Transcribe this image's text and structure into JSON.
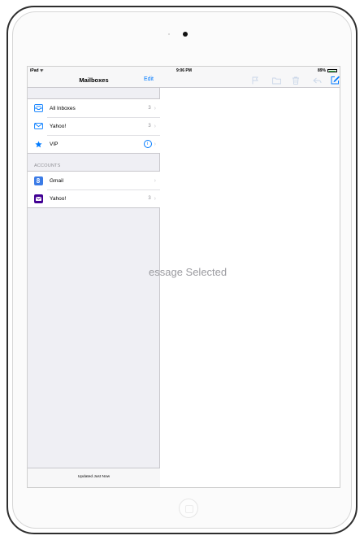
{
  "status_bar": {
    "device": "iPad",
    "time": "9:06 PM",
    "battery": "89%"
  },
  "sidebar": {
    "title": "Mailboxes",
    "edit_label": "Edit",
    "mailboxes": [
      {
        "label": "All Inboxes",
        "count": "3",
        "icon": "inbox-tray-icon"
      },
      {
        "label": "Yahoo!",
        "count": "3",
        "icon": "envelope-icon"
      },
      {
        "label": "VIP",
        "count": "",
        "icon": "star-icon"
      }
    ],
    "accounts_header": "ACCOUNTS",
    "accounts": [
      {
        "label": "Gmail",
        "count": "",
        "icon": "gmail-logo-icon"
      },
      {
        "label": "Yahoo!",
        "count": "3",
        "icon": "yahoo-logo-icon"
      }
    ],
    "footer": "Updated Just Now"
  },
  "detail": {
    "empty_message": "essage Selected",
    "toolbar_icons": [
      "flag-icon",
      "folder-icon",
      "trash-icon",
      "reply-icon",
      "compose-icon"
    ]
  },
  "colors": {
    "accent": "#007aff",
    "gmail": "#3b7be6",
    "yahoo": "#410093",
    "battery": "#4cd964"
  }
}
